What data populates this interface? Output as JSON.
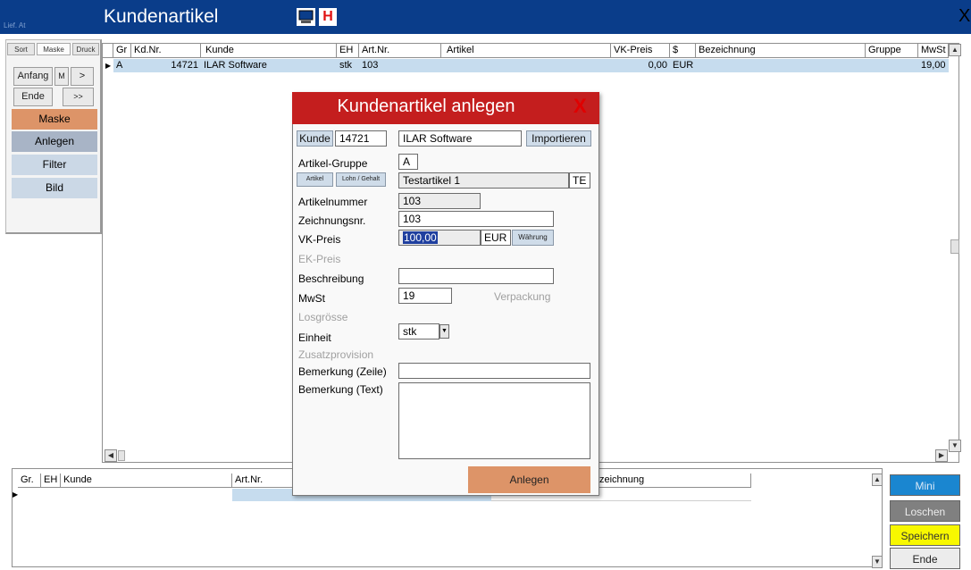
{
  "window": {
    "corner_label": "Lief. At",
    "title": "Kundenartikel",
    "h_badge": "H",
    "close_glyph": "X"
  },
  "left_panel": {
    "tabs": [
      "Sort",
      "Maske",
      "Druck"
    ],
    "nav": {
      "first": "Anfang",
      "mid": "M",
      "next": ">",
      "last": "Ende",
      "next_page": ">>"
    },
    "buttons": {
      "maske": "Maske",
      "anlegen": "Anlegen",
      "filter": "Filter",
      "bild": "Bild"
    }
  },
  "top_grid": {
    "columns": [
      "Gr",
      "Kd.Nr.",
      "Kunde",
      "EH",
      "Art.Nr.",
      "Artikel",
      "VK-Preis",
      "$",
      "Bezeichnung",
      "Gruppe",
      "MwSt"
    ],
    "row": {
      "gr": "A",
      "kdnr": "14721",
      "kunde": "ILAR Software",
      "eh": "stk",
      "artnr": "103",
      "artikel": "",
      "vkpreis": "0,00",
      "waehrung": "EUR",
      "bezeichnung": "",
      "gruppe": "",
      "mwst": "19,00"
    }
  },
  "bottom_grid": {
    "columns": [
      "Gr.",
      "EH",
      "Kunde",
      "Art.Nr.",
      "zeichnung"
    ]
  },
  "right_buttons": {
    "mini": "Mini",
    "loeschen": "Loschen",
    "speichern": "Speichern",
    "ende": "Ende"
  },
  "dialog": {
    "title": "Kundenartikel anlegen",
    "close": "X",
    "kunde_label": "Kunde",
    "kunde_nr": "14721",
    "kunde_name": "ILAR Software",
    "importieren": "Importieren",
    "artikel_gruppe_label": "Artikel-Gruppe",
    "artikel_gruppe_value": "A",
    "artikel_btn": "Artikel",
    "lohn_btn": "Lohn / Gehalt",
    "artikel_name": "Testartikel 1",
    "artikel_suffix": "TE",
    "artikelnummer_label": "Artikelnummer",
    "artikelnummer_value": "103",
    "zeichnungsnr_label": "Zeichnungsnr.",
    "zeichnungsnr_value": "103",
    "vkpreis_label": "VK-Preis",
    "vkpreis_value": "100,00",
    "currency": "EUR",
    "waehrung_btn": "Währung",
    "ekpreis_label": "EK-Preis",
    "beschreibung_label": "Beschreibung",
    "beschreibung_value": "",
    "mwst_label": "MwSt",
    "mwst_value": "19",
    "verpackung_label": "Verpackung",
    "losgroesse_label": "Losgrösse",
    "einheit_label": "Einheit",
    "einheit_value": "stk",
    "zusatzprovision_label": "Zusatzprovision",
    "bemerkung_zeile_label": "Bemerkung (Zeile)",
    "bemerkung_zeile_value": "",
    "bemerkung_text_label": "Bemerkung (Text)",
    "bemerkung_text_value": "",
    "anlegen_btn": "Anlegen"
  },
  "colors": {
    "titlebar": "#0a3d8a",
    "dialog_header": "#c41e1e",
    "maske_button": "#dd9468",
    "anlegen_button": "#a8b4c6",
    "mini_button": "#1a86d0",
    "loeschen_button": "#808080",
    "speichern_button": "#f8f800",
    "selection_row": "#c6dcee"
  }
}
